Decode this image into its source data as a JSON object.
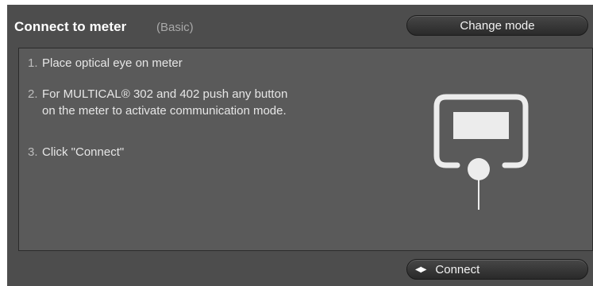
{
  "dialog": {
    "title": "Connect to meter",
    "mode_hint": "(Basic)",
    "change_mode_label": "Change mode"
  },
  "instructions": [
    {
      "number": "1.",
      "text": "Place optical eye on meter"
    },
    {
      "number": "2.",
      "line1": "For MULTICAL® 302 and 402 push any button",
      "line2": "on the meter to activate communication mode."
    },
    {
      "number": "3.",
      "text": "Click \"Connect\""
    }
  ],
  "footer": {
    "connect_icon": "left-right-arrows-icon",
    "connect_label": "Connect"
  },
  "illustration": {
    "icon": "meter-optical-eye-icon"
  },
  "colors": {
    "panel_bg": "#4d4d4d",
    "content_bg": "#5a5a5a",
    "text": "#e6e6e6",
    "muted": "#a9a9a9"
  }
}
